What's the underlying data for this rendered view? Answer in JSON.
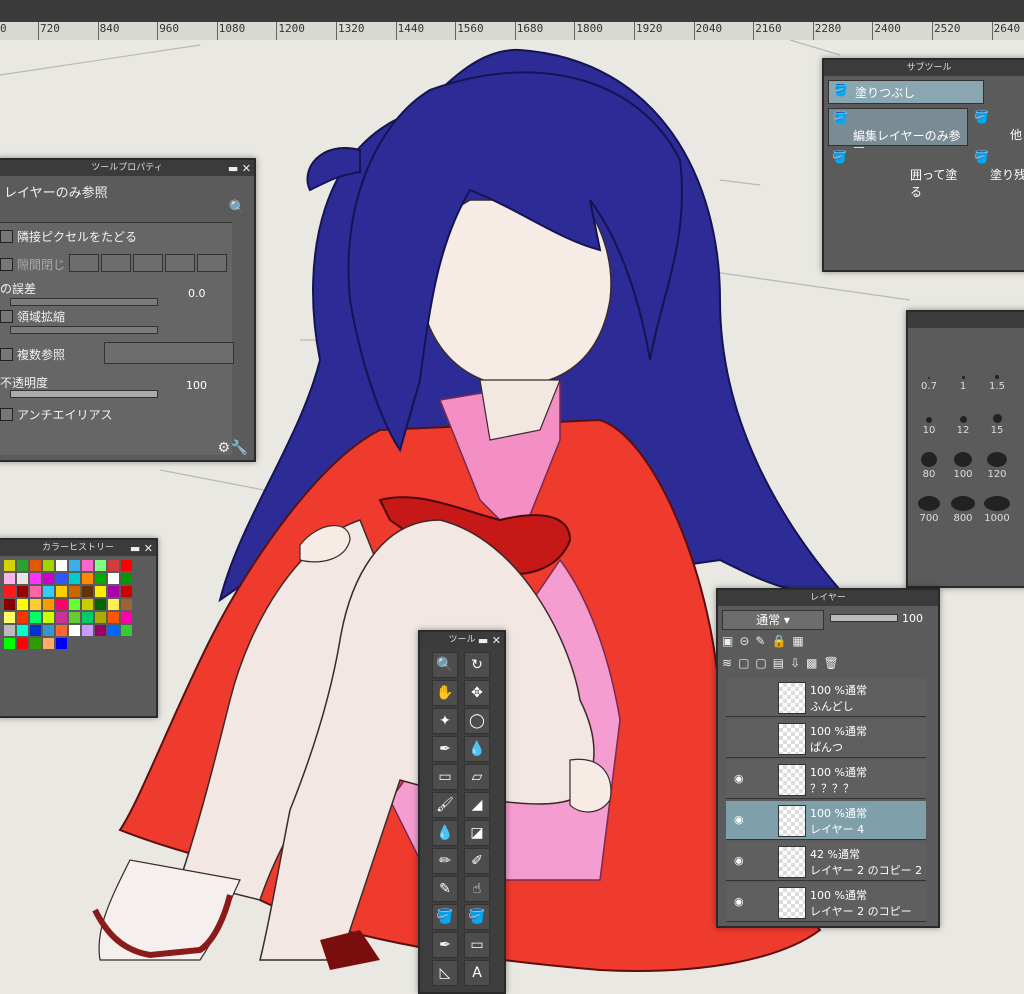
{
  "ruler": {
    "ticks": [
      "0",
      "720",
      "840",
      "960",
      "1080",
      "1200",
      "1320",
      "1440",
      "1560",
      "1680",
      "1800",
      "1920",
      "2040",
      "2160",
      "2280",
      "2400",
      "2520",
      "2640"
    ]
  },
  "tool_property": {
    "title": "ツールプロパティ",
    "header": "レイヤーのみ参照",
    "opt_adjacent": "隣接ピクセルをたどる",
    "opt_gap": "隙間閉じ",
    "opt_tolerance": "の誤差",
    "tolerance_value": "0.0",
    "opt_expand": "領域拡縮",
    "opt_multi": "複数参照",
    "opt_opacity": "不透明度",
    "opacity_value": "100",
    "opt_antialias": "アンチエイリアス"
  },
  "sub_tool": {
    "title": "サブツール",
    "item_fill": "塗りつぶし",
    "item_edit_layer": "編集レイヤーのみ参照",
    "item_other": "他",
    "item_enclose": "囲って塗る",
    "item_paint": "塗り残"
  },
  "color_history": {
    "title": "カラーヒストリー",
    "colors": [
      "#d4d400",
      "#2ea02e",
      "#e05a00",
      "#a0d400",
      "#ffffff",
      "#3cb0e6",
      "#ff66cc",
      "#80ff80",
      "#d43c3c",
      "#ff0000",
      "#ffb3e6",
      "#e6e6e6",
      "#ff33ff",
      "#cc00cc",
      "#3355ff",
      "#00cccc",
      "#ff8800",
      "#00aa00",
      "#ffffff",
      "#009900",
      "#ff1a1a",
      "#990000",
      "#ff66aa",
      "#33ccff",
      "#ffcc00",
      "#cc6600",
      "#663300",
      "#ffee00",
      "#aa00aa",
      "#cc0000",
      "#880000",
      "#ffff00",
      "#ffcc33",
      "#ff9900",
      "#ff0066",
      "#66ff33",
      "#cccc00",
      "#006600",
      "#ffee55",
      "#996633",
      "#ffff66",
      "#ff3300",
      "#00ff66",
      "#ccff00",
      "#cc3399",
      "#66cc33",
      "#00cc66",
      "#aaaa00",
      "#ff5500",
      "#ff00aa",
      "#bbbbbb",
      "#00ffcc",
      "#0033cc",
      "#3399cc",
      "#ff6633",
      "#ffffff",
      "#cc99ff",
      "#990066",
      "#0066ff",
      "#33cc33",
      "#00ff00",
      "#ff0000",
      "#339900",
      "#ffaa66",
      "#0000ff"
    ]
  },
  "tools": {
    "title": "ツール",
    "text_tool_icon": "A"
  },
  "brush_size": {
    "sizes": [
      "0.7",
      "1",
      "1.5",
      "10",
      "12",
      "15",
      "80",
      "100",
      "120",
      "700",
      "800",
      "1000"
    ]
  },
  "layer": {
    "title": "レイヤー",
    "blend_mode": "通常",
    "opacity": "100",
    "rows": [
      {
        "pct": "100 %通常",
        "name": "ふんどし"
      },
      {
        "pct": "100 %通常",
        "name": "ぱんつ"
      },
      {
        "pct": "100 %通常",
        "name": "？？？？"
      },
      {
        "pct": "100 %通常",
        "name": "レイヤー 4"
      },
      {
        "pct": "42 %通常",
        "name": "レイヤー 2 のコピー 2"
      },
      {
        "pct": "100 %通常",
        "name": "レイヤー 2 のコピー"
      }
    ]
  }
}
